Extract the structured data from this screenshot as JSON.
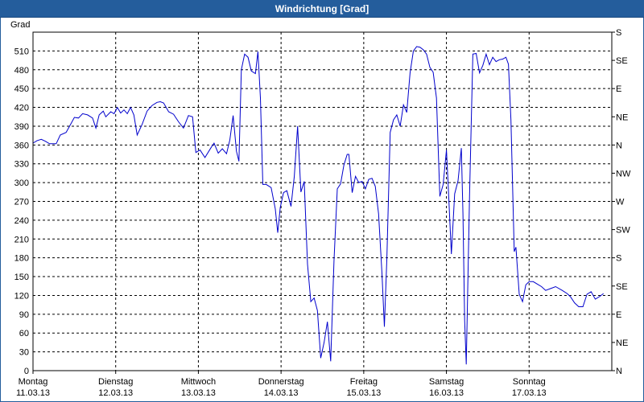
{
  "window": {
    "title": "Windrichtung [Grad]"
  },
  "colors": {
    "titlebar": "#245d9c",
    "line": "#0000cc",
    "grid": "#000000"
  },
  "chart_data": {
    "type": "line",
    "title": "Windrichtung [Grad]",
    "ylabel": "Grad",
    "ylim": [
      0,
      540
    ],
    "yticks": [
      0,
      30,
      60,
      90,
      120,
      150,
      180,
      210,
      240,
      270,
      300,
      330,
      360,
      390,
      420,
      450,
      480,
      510
    ],
    "right_ticks": [
      {
        "value": 0,
        "label": "N"
      },
      {
        "value": 45,
        "label": "NE"
      },
      {
        "value": 90,
        "label": "E"
      },
      {
        "value": 135,
        "label": "SE"
      },
      {
        "value": 180,
        "label": "S"
      },
      {
        "value": 225,
        "label": "SW"
      },
      {
        "value": 270,
        "label": "W"
      },
      {
        "value": 315,
        "label": "NW"
      },
      {
        "value": 360,
        "label": "N"
      },
      {
        "value": 405,
        "label": "NE"
      },
      {
        "value": 450,
        "label": "E"
      },
      {
        "value": 495,
        "label": "SE"
      },
      {
        "value": 540,
        "label": "S"
      }
    ],
    "xlim": [
      0,
      7
    ],
    "xticks": [
      {
        "day": "Montag",
        "date": "11.03.13"
      },
      {
        "day": "Dienstag",
        "date": "12.03.13"
      },
      {
        "day": "Mittwoch",
        "date": "13.03.13"
      },
      {
        "day": "Donnerstag",
        "date": "14.03.13"
      },
      {
        "day": "Freitag",
        "date": "15.03.13"
      },
      {
        "day": "Samstag",
        "date": "16.03.13"
      },
      {
        "day": "Sonntag",
        "date": "17.03.13"
      }
    ],
    "grid": true,
    "series": [
      {
        "points": [
          [
            0.0,
            363
          ],
          [
            0.05,
            367
          ],
          [
            0.1,
            369
          ],
          [
            0.15,
            366
          ],
          [
            0.2,
            362
          ],
          [
            0.28,
            362
          ],
          [
            0.33,
            376
          ],
          [
            0.4,
            380
          ],
          [
            0.46,
            394
          ],
          [
            0.5,
            404
          ],
          [
            0.55,
            403
          ],
          [
            0.6,
            410
          ],
          [
            0.66,
            408
          ],
          [
            0.72,
            403
          ],
          [
            0.76,
            387
          ],
          [
            0.8,
            408
          ],
          [
            0.85,
            414
          ],
          [
            0.88,
            405
          ],
          [
            0.94,
            413
          ],
          [
            0.98,
            410
          ],
          [
            1.02,
            420
          ],
          [
            1.06,
            411
          ],
          [
            1.1,
            416
          ],
          [
            1.14,
            410
          ],
          [
            1.18,
            420
          ],
          [
            1.22,
            408
          ],
          [
            1.26,
            376
          ],
          [
            1.32,
            393
          ],
          [
            1.38,
            414
          ],
          [
            1.44,
            423
          ],
          [
            1.5,
            428
          ],
          [
            1.54,
            429
          ],
          [
            1.58,
            427
          ],
          [
            1.64,
            413
          ],
          [
            1.7,
            409
          ],
          [
            1.76,
            397
          ],
          [
            1.82,
            387
          ],
          [
            1.88,
            407
          ],
          [
            1.93,
            405
          ],
          [
            1.97,
            348
          ],
          [
            2.02,
            352
          ],
          [
            2.08,
            340
          ],
          [
            2.15,
            355
          ],
          [
            2.19,
            363
          ],
          [
            2.24,
            347
          ],
          [
            2.29,
            354
          ],
          [
            2.34,
            346
          ],
          [
            2.38,
            368
          ],
          [
            2.42,
            407
          ],
          [
            2.46,
            350
          ],
          [
            2.49,
            334
          ],
          [
            2.52,
            480
          ],
          [
            2.56,
            505
          ],
          [
            2.6,
            500
          ],
          [
            2.64,
            478
          ],
          [
            2.69,
            474
          ],
          [
            2.72,
            509
          ],
          [
            2.75,
            435
          ],
          [
            2.78,
            297
          ],
          [
            2.82,
            297
          ],
          [
            2.88,
            292
          ],
          [
            2.93,
            258
          ],
          [
            2.96,
            220
          ],
          [
            2.99,
            260
          ],
          [
            3.03,
            284
          ],
          [
            3.07,
            287
          ],
          [
            3.12,
            262
          ],
          [
            3.16,
            310
          ],
          [
            3.2,
            390
          ],
          [
            3.24,
            285
          ],
          [
            3.28,
            302
          ],
          [
            3.32,
            170
          ],
          [
            3.36,
            110
          ],
          [
            3.4,
            116
          ],
          [
            3.44,
            96
          ],
          [
            3.48,
            20
          ],
          [
            3.52,
            45
          ],
          [
            3.56,
            78
          ],
          [
            3.6,
            15
          ],
          [
            3.64,
            175
          ],
          [
            3.68,
            290
          ],
          [
            3.72,
            298
          ],
          [
            3.76,
            328
          ],
          [
            3.8,
            345
          ],
          [
            3.82,
            345
          ],
          [
            3.86,
            284
          ],
          [
            3.9,
            310
          ],
          [
            3.94,
            300
          ],
          [
            3.98,
            302
          ],
          [
            4.02,
            290
          ],
          [
            4.06,
            305
          ],
          [
            4.1,
            307
          ],
          [
            4.14,
            294
          ],
          [
            4.18,
            250
          ],
          [
            4.22,
            155
          ],
          [
            4.25,
            70
          ],
          [
            4.28,
            180
          ],
          [
            4.32,
            380
          ],
          [
            4.36,
            400
          ],
          [
            4.4,
            408
          ],
          [
            4.44,
            390
          ],
          [
            4.48,
            424
          ],
          [
            4.52,
            412
          ],
          [
            4.56,
            475
          ],
          [
            4.6,
            510
          ],
          [
            4.64,
            517
          ],
          [
            4.68,
            516
          ],
          [
            4.72,
            512
          ],
          [
            4.76,
            505
          ],
          [
            4.8,
            484
          ],
          [
            4.84,
            476
          ],
          [
            4.88,
            435
          ],
          [
            4.92,
            278
          ],
          [
            4.96,
            297
          ],
          [
            5.0,
            352
          ],
          [
            5.02,
            300
          ],
          [
            5.06,
            186
          ],
          [
            5.1,
            282
          ],
          [
            5.14,
            303
          ],
          [
            5.18,
            355
          ],
          [
            5.2,
            250
          ],
          [
            5.22,
            80
          ],
          [
            5.24,
            10
          ],
          [
            5.28,
            280
          ],
          [
            5.32,
            505
          ],
          [
            5.36,
            506
          ],
          [
            5.4,
            475
          ],
          [
            5.44,
            487
          ],
          [
            5.48,
            505
          ],
          [
            5.52,
            488
          ],
          [
            5.56,
            500
          ],
          [
            5.6,
            493
          ],
          [
            5.64,
            496
          ],
          [
            5.68,
            497
          ],
          [
            5.72,
            500
          ],
          [
            5.75,
            489
          ],
          [
            5.78,
            400
          ],
          [
            5.82,
            190
          ],
          [
            5.84,
            197
          ],
          [
            5.88,
            122
          ],
          [
            5.92,
            110
          ],
          [
            5.96,
            137
          ],
          [
            6.0,
            142
          ],
          [
            6.05,
            142
          ],
          [
            6.1,
            138
          ],
          [
            6.15,
            134
          ],
          [
            6.2,
            128
          ],
          [
            6.26,
            131
          ],
          [
            6.32,
            134
          ],
          [
            6.4,
            128
          ],
          [
            6.46,
            123
          ],
          [
            6.5,
            118
          ],
          [
            6.55,
            108
          ],
          [
            6.6,
            102
          ],
          [
            6.65,
            102
          ],
          [
            6.7,
            122
          ],
          [
            6.75,
            126
          ],
          [
            6.8,
            114
          ],
          [
            6.85,
            118
          ],
          [
            6.9,
            123
          ]
        ]
      }
    ]
  }
}
